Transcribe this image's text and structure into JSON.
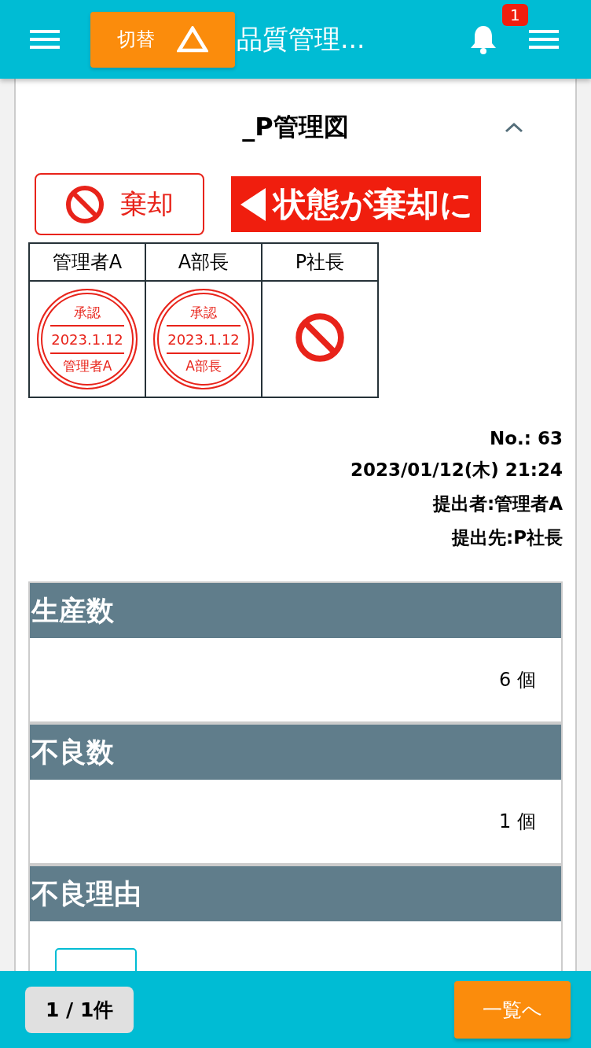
{
  "header": {
    "switch_button": {
      "label": "切替"
    },
    "title": "品質管理...",
    "notification_count": "1"
  },
  "form": {
    "title": "_P管理図",
    "expanded": true,
    "status_button": "棄却",
    "status_callout": "状態が棄却に",
    "approvals": [
      {
        "role": "管理者A",
        "kind": "stamp",
        "stamp": {
          "label": "承認",
          "date": "2023.1.12",
          "name": "管理者A"
        }
      },
      {
        "role": "A部長",
        "kind": "stamp",
        "stamp": {
          "label": "承認",
          "date": "2023.1.12",
          "name": "A部長"
        }
      },
      {
        "role": "P社長",
        "kind": "rejected"
      }
    ],
    "meta": [
      "No.: 63",
      "2023/01/12(木) 21:24",
      "提出者:管理者A",
      "提出先:P社長"
    ],
    "fields": [
      {
        "label": "生産数",
        "kind": "value",
        "value": "6 個"
      },
      {
        "label": "不良数",
        "kind": "value",
        "value": "1 個"
      },
      {
        "label": "不良理由",
        "kind": "toggle"
      }
    ]
  },
  "footer": {
    "pager": "1 / 1件",
    "list_button": "一覧へ"
  }
}
